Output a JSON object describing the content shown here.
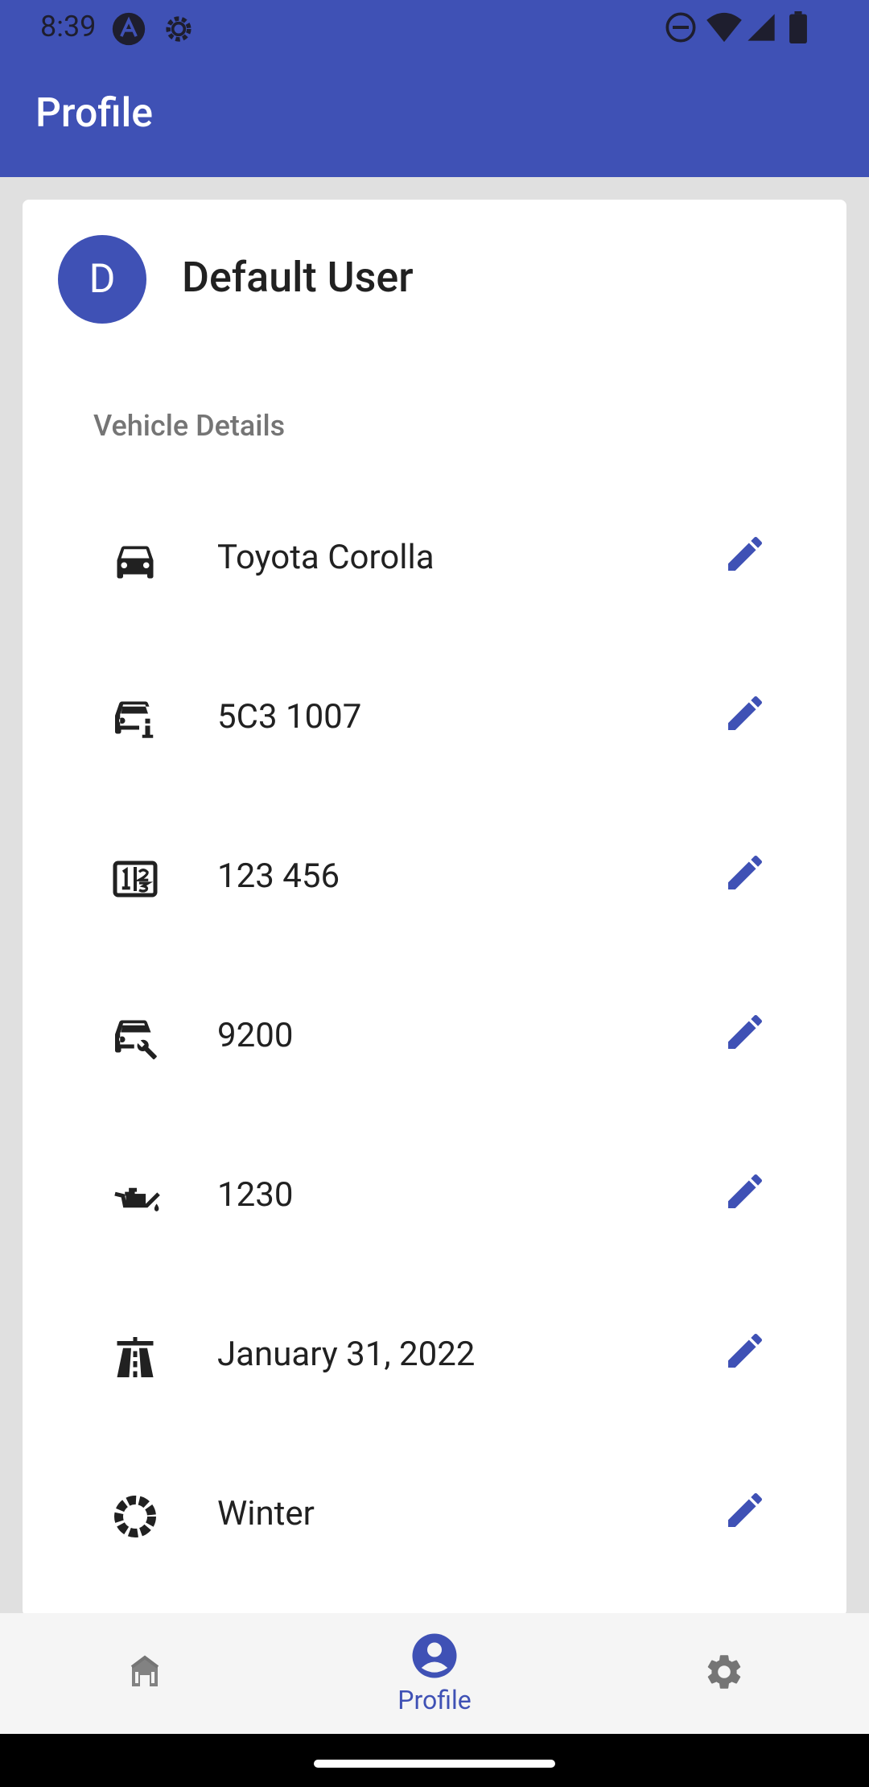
{
  "status_bar": {
    "time": "8:39",
    "icons": [
      "app-a-icon",
      "settings-gear-icon",
      "dnd-icon",
      "wifi-icon",
      "signal-icon",
      "battery-icon"
    ]
  },
  "app_bar": {
    "title": "Profile"
  },
  "profile": {
    "avatar_letter": "D",
    "name": "Default User",
    "section_label": "Vehicle Details",
    "items": [
      {
        "icon": "car-icon",
        "value": "Toyota Corolla"
      },
      {
        "icon": "car-info-icon",
        "value": "5C3 1007"
      },
      {
        "icon": "number-plate-icon",
        "value": "123 456"
      },
      {
        "icon": "car-repair-icon",
        "value": "9200"
      },
      {
        "icon": "oil-can-icon",
        "value": "1230"
      },
      {
        "icon": "road-icon",
        "value": "January 31, 2022"
      },
      {
        "icon": "tire-icon",
        "value": "Winter"
      }
    ]
  },
  "bottom_nav": {
    "items": [
      {
        "icon": "home-icon",
        "label": ""
      },
      {
        "icon": "account-icon",
        "label": "Profile"
      },
      {
        "icon": "settings-icon",
        "label": ""
      }
    ],
    "active_index": 1
  },
  "colors": {
    "primary": "#3f51b5",
    "background": "#e0e0e0",
    "card": "#ffffff",
    "nav_bg": "#f5f5f5",
    "muted_text": "#757575"
  }
}
